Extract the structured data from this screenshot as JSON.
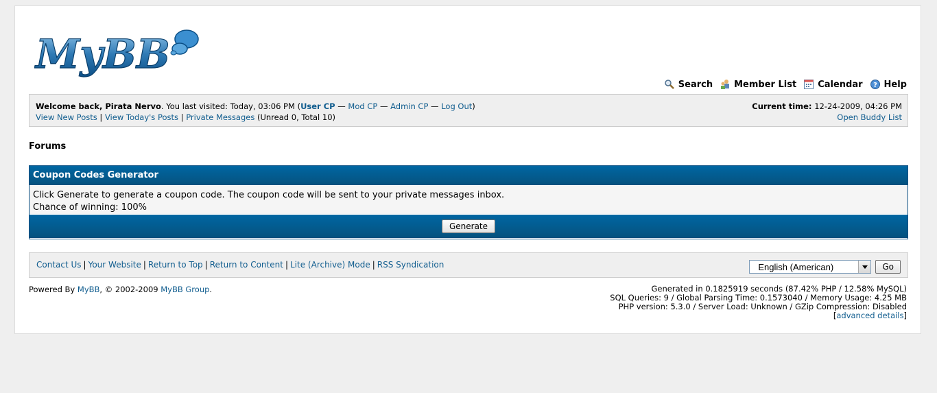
{
  "logo": {
    "text": "MyBB"
  },
  "menu": [
    {
      "label": "Search",
      "icon": "search-icon"
    },
    {
      "label": "Member List",
      "icon": "member-list-icon"
    },
    {
      "label": "Calendar",
      "icon": "calendar-icon"
    },
    {
      "label": "Help",
      "icon": "help-icon"
    }
  ],
  "panel": {
    "welcome_prefix": "Welcome back, Pirata Nervo",
    "last_visited": ". You last visited: Today, 03:06 PM (",
    "user_cp": "User CP",
    "dash1": " — ",
    "mod_cp": "Mod CP",
    "dash2": " — ",
    "admin_cp": "Admin CP",
    "dash3": " — ",
    "log_out": "Log Out",
    "close_paren": ")",
    "view_new_posts": "View New Posts",
    "view_todays_posts": "View Today's Posts",
    "private_messages": "Private Messages",
    "pm_counts": "(Unread 0, Total 10)",
    "current_time_label": "Current time:",
    "current_time_value": "12-24-2009, 04:26 PM",
    "open_buddy_list": "Open Buddy List",
    "separator": "|"
  },
  "breadcrumb": {
    "title": "Forums"
  },
  "coupon": {
    "header": "Coupon Codes Generator",
    "line1": "Click Generate to generate a coupon code. The coupon code will be sent to your private messages inbox.",
    "line2": "Chance of winning: 100%",
    "button": "Generate"
  },
  "footer": {
    "links": [
      "Contact Us",
      "Your Website",
      "Return to Top",
      "Return to Content",
      "Lite (Archive) Mode",
      "RSS Syndication"
    ],
    "separator": "|",
    "language": "English (American)",
    "go": "Go"
  },
  "powered": {
    "prefix": "Powered By ",
    "mybb": "MyBB",
    "middle": ", © 2002-2009 ",
    "group": "MyBB Group",
    "suffix": "."
  },
  "debug": {
    "line1": "Generated in 0.1825919 seconds (87.42% PHP / 12.58% MySQL)",
    "line2": "SQL Queries: 9 / Global Parsing Time: 0.1573040 / Memory Usage: 4.25 MB",
    "line3": "PHP version: 5.3.0 / Server Load: Unknown / GZip Compression: Disabled",
    "bracket_open": "[",
    "advanced": "advanced details",
    "bracket_close": "]"
  },
  "colors": {
    "header_blue": "#045889",
    "link": "#0f5c8e",
    "panel_bg": "#efefef"
  }
}
